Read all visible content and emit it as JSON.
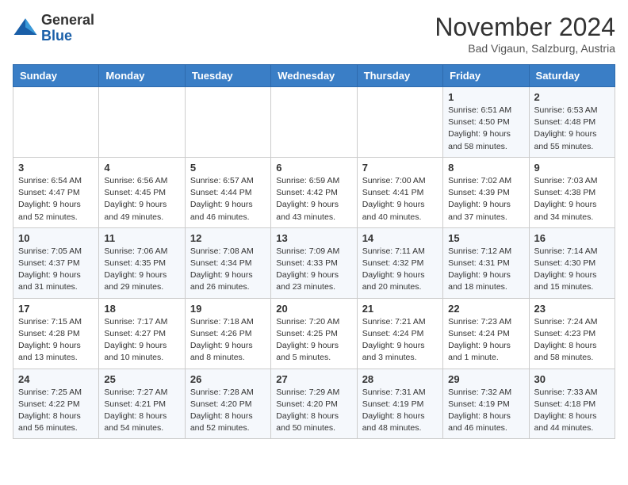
{
  "header": {
    "logo_line1": "General",
    "logo_line2": "Blue",
    "month_title": "November 2024",
    "location": "Bad Vigaun, Salzburg, Austria"
  },
  "days_of_week": [
    "Sunday",
    "Monday",
    "Tuesday",
    "Wednesday",
    "Thursday",
    "Friday",
    "Saturday"
  ],
  "weeks": [
    [
      {
        "day": "",
        "info": ""
      },
      {
        "day": "",
        "info": ""
      },
      {
        "day": "",
        "info": ""
      },
      {
        "day": "",
        "info": ""
      },
      {
        "day": "",
        "info": ""
      },
      {
        "day": "1",
        "info": "Sunrise: 6:51 AM\nSunset: 4:50 PM\nDaylight: 9 hours\nand 58 minutes."
      },
      {
        "day": "2",
        "info": "Sunrise: 6:53 AM\nSunset: 4:48 PM\nDaylight: 9 hours\nand 55 minutes."
      }
    ],
    [
      {
        "day": "3",
        "info": "Sunrise: 6:54 AM\nSunset: 4:47 PM\nDaylight: 9 hours\nand 52 minutes."
      },
      {
        "day": "4",
        "info": "Sunrise: 6:56 AM\nSunset: 4:45 PM\nDaylight: 9 hours\nand 49 minutes."
      },
      {
        "day": "5",
        "info": "Sunrise: 6:57 AM\nSunset: 4:44 PM\nDaylight: 9 hours\nand 46 minutes."
      },
      {
        "day": "6",
        "info": "Sunrise: 6:59 AM\nSunset: 4:42 PM\nDaylight: 9 hours\nand 43 minutes."
      },
      {
        "day": "7",
        "info": "Sunrise: 7:00 AM\nSunset: 4:41 PM\nDaylight: 9 hours\nand 40 minutes."
      },
      {
        "day": "8",
        "info": "Sunrise: 7:02 AM\nSunset: 4:39 PM\nDaylight: 9 hours\nand 37 minutes."
      },
      {
        "day": "9",
        "info": "Sunrise: 7:03 AM\nSunset: 4:38 PM\nDaylight: 9 hours\nand 34 minutes."
      }
    ],
    [
      {
        "day": "10",
        "info": "Sunrise: 7:05 AM\nSunset: 4:37 PM\nDaylight: 9 hours\nand 31 minutes."
      },
      {
        "day": "11",
        "info": "Sunrise: 7:06 AM\nSunset: 4:35 PM\nDaylight: 9 hours\nand 29 minutes."
      },
      {
        "day": "12",
        "info": "Sunrise: 7:08 AM\nSunset: 4:34 PM\nDaylight: 9 hours\nand 26 minutes."
      },
      {
        "day": "13",
        "info": "Sunrise: 7:09 AM\nSunset: 4:33 PM\nDaylight: 9 hours\nand 23 minutes."
      },
      {
        "day": "14",
        "info": "Sunrise: 7:11 AM\nSunset: 4:32 PM\nDaylight: 9 hours\nand 20 minutes."
      },
      {
        "day": "15",
        "info": "Sunrise: 7:12 AM\nSunset: 4:31 PM\nDaylight: 9 hours\nand 18 minutes."
      },
      {
        "day": "16",
        "info": "Sunrise: 7:14 AM\nSunset: 4:30 PM\nDaylight: 9 hours\nand 15 minutes."
      }
    ],
    [
      {
        "day": "17",
        "info": "Sunrise: 7:15 AM\nSunset: 4:28 PM\nDaylight: 9 hours\nand 13 minutes."
      },
      {
        "day": "18",
        "info": "Sunrise: 7:17 AM\nSunset: 4:27 PM\nDaylight: 9 hours\nand 10 minutes."
      },
      {
        "day": "19",
        "info": "Sunrise: 7:18 AM\nSunset: 4:26 PM\nDaylight: 9 hours\nand 8 minutes."
      },
      {
        "day": "20",
        "info": "Sunrise: 7:20 AM\nSunset: 4:25 PM\nDaylight: 9 hours\nand 5 minutes."
      },
      {
        "day": "21",
        "info": "Sunrise: 7:21 AM\nSunset: 4:24 PM\nDaylight: 9 hours\nand 3 minutes."
      },
      {
        "day": "22",
        "info": "Sunrise: 7:23 AM\nSunset: 4:24 PM\nDaylight: 9 hours\nand 1 minute."
      },
      {
        "day": "23",
        "info": "Sunrise: 7:24 AM\nSunset: 4:23 PM\nDaylight: 8 hours\nand 58 minutes."
      }
    ],
    [
      {
        "day": "24",
        "info": "Sunrise: 7:25 AM\nSunset: 4:22 PM\nDaylight: 8 hours\nand 56 minutes."
      },
      {
        "day": "25",
        "info": "Sunrise: 7:27 AM\nSunset: 4:21 PM\nDaylight: 8 hours\nand 54 minutes."
      },
      {
        "day": "26",
        "info": "Sunrise: 7:28 AM\nSunset: 4:20 PM\nDaylight: 8 hours\nand 52 minutes."
      },
      {
        "day": "27",
        "info": "Sunrise: 7:29 AM\nSunset: 4:20 PM\nDaylight: 8 hours\nand 50 minutes."
      },
      {
        "day": "28",
        "info": "Sunrise: 7:31 AM\nSunset: 4:19 PM\nDaylight: 8 hours\nand 48 minutes."
      },
      {
        "day": "29",
        "info": "Sunrise: 7:32 AM\nSunset: 4:19 PM\nDaylight: 8 hours\nand 46 minutes."
      },
      {
        "day": "30",
        "info": "Sunrise: 7:33 AM\nSunset: 4:18 PM\nDaylight: 8 hours\nand 44 minutes."
      }
    ]
  ]
}
